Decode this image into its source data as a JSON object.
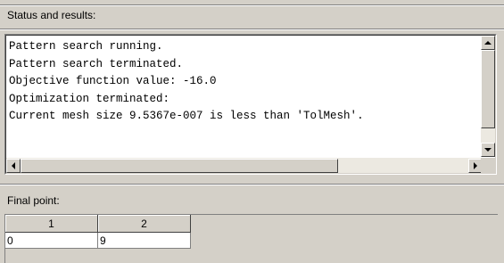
{
  "status": {
    "label": "Status and results:",
    "lines": [
      "Pattern search running.",
      "Pattern search terminated.",
      "Objective function value: -16.0",
      "Optimization terminated:",
      "Current mesh size 9.5367e-007 is less than 'TolMesh'."
    ]
  },
  "final": {
    "label": "Final point:",
    "columns": [
      "1",
      "2"
    ],
    "values": [
      "0",
      "9"
    ]
  }
}
